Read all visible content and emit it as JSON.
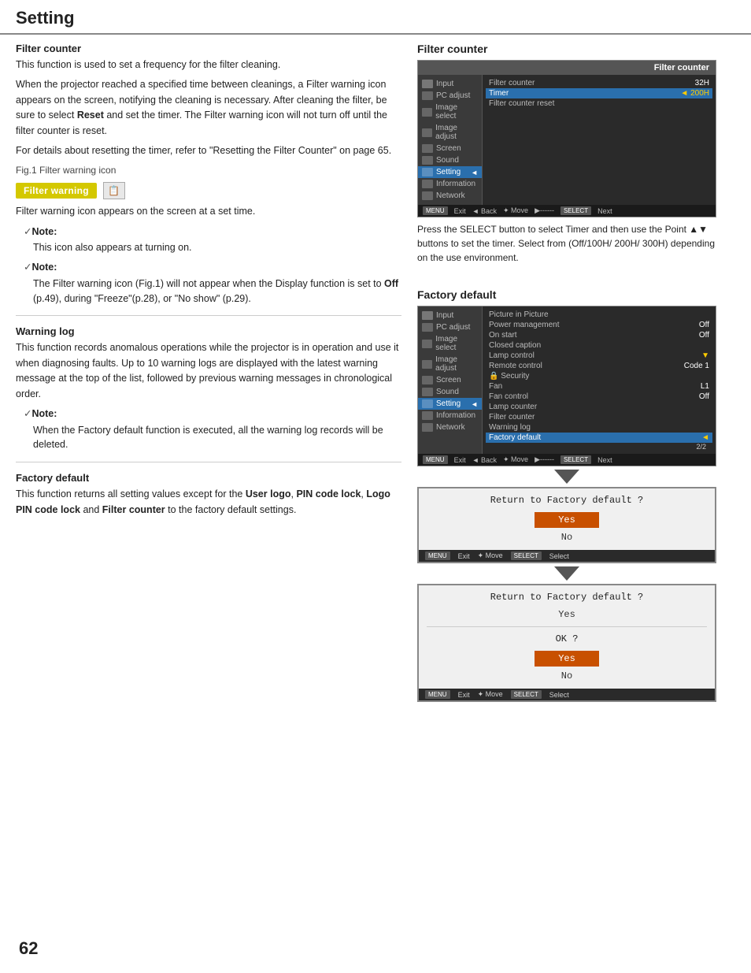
{
  "header": {
    "title": "Setting"
  },
  "page_number": "62",
  "left": {
    "filter_counter": {
      "title": "Filter counter",
      "para1": "This function is used to set a frequency for the filter cleaning.",
      "para2": "When the projector reached a specified time between cleanings, a Filter warning icon appears on the screen, notifying the cleaning is necessary. After cleaning the filter, be sure to select Reset and set the timer. The Filter warning icon will not turn off until the filter counter is reset.",
      "para3": "For details about resetting the timer, refer to \"Resetting the Filter Counter\" on page 65.",
      "fig_label": "Fig.1   Filter warning icon",
      "filter_warning_badge": "Filter warning",
      "note1_label": "Note:",
      "note1_text": "This icon also appears at turning on.",
      "note2_label": "Note:",
      "note2_text": "The Filter warning icon (Fig.1) will not appear when the Display function is set to Off (p.49), during \"Freeze\"(p.28), or \"No show\" (p.29).",
      "para4": "Filter warning icon appears on the screen at a set time."
    },
    "warning_log": {
      "title": "Warning log",
      "para1": "This function records anomalous operations while the projector is in operation and use it when diagnosing faults. Up to 10 warning logs are displayed with the latest warning message at the top of the list, followed by previous warning messages in chronological order.",
      "note_label": "Note:",
      "note_text": "When the Factory default function is executed, all the warning log records will be deleted."
    },
    "factory_default": {
      "title": "Factory default",
      "para1": "This function returns all setting values except for the User logo, PIN code lock, Logo PIN code lock and Filter counter to the factory default settings."
    }
  },
  "right": {
    "filter_counter_section": {
      "label": "Filter counter",
      "panel": {
        "title": "Filter counter",
        "rows": [
          {
            "label": "Filter counter",
            "value": "32H"
          },
          {
            "label": "Timer",
            "value": "200H",
            "highlighted": true
          },
          {
            "label": "Filter counter reset",
            "value": ""
          }
        ],
        "menu_items": [
          {
            "label": "Input",
            "icon": "input"
          },
          {
            "label": "PC adjust",
            "icon": "pc"
          },
          {
            "label": "Image select",
            "icon": "img"
          },
          {
            "label": "Image adjust",
            "icon": "imgadj"
          },
          {
            "label": "Screen",
            "icon": "screen"
          },
          {
            "label": "Sound",
            "icon": "sound"
          },
          {
            "label": "Setting",
            "icon": "setting",
            "active": true
          },
          {
            "label": "Information",
            "icon": "info"
          },
          {
            "label": "Network",
            "icon": "network"
          }
        ],
        "bottom": [
          "Exit",
          "Back",
          "Move",
          "-----",
          "Next"
        ]
      },
      "desc": "Press the SELECT button to select  Timer and then use the Point ▲▼ buttons to set the timer. Select from (Off/100H/ 200H/ 300H) depending on the use environment."
    },
    "factory_default_section": {
      "label": "Factory default",
      "panel": {
        "rows": [
          {
            "label": "Picture in Picture",
            "value": ""
          },
          {
            "label": "Power management",
            "value": "Off"
          },
          {
            "label": "On start",
            "value": "Off"
          },
          {
            "label": "Closed caption",
            "value": ""
          },
          {
            "label": "Lamp control",
            "value": "▼"
          },
          {
            "label": "Remote control",
            "value": "Code 1"
          },
          {
            "label": "🔒 Security",
            "value": ""
          },
          {
            "label": "Fan",
            "value": "L1"
          },
          {
            "label": "Fan control",
            "value": "Off"
          },
          {
            "label": "Lamp counter",
            "value": ""
          },
          {
            "label": "Filter counter",
            "value": ""
          },
          {
            "label": "Warning log",
            "value": ""
          },
          {
            "label": "Factory default",
            "value": "◄",
            "highlighted": true
          }
        ],
        "page_indicator": "2/2",
        "bottom": [
          "Exit",
          "Back",
          "Move",
          "-----",
          "Next"
        ]
      }
    },
    "dialog1": {
      "title": "Return to Factory default ?",
      "buttons": [
        "Yes",
        "No"
      ],
      "active_button": "Yes",
      "bottom": [
        "Exit",
        "Move",
        "Select"
      ]
    },
    "dialog2": {
      "title": "Return to Factory default ?",
      "yes_label": "Yes",
      "ok_label": "OK ?",
      "ok_buttons": [
        "Yes",
        "No"
      ],
      "active_ok_button": "Yes",
      "bottom": [
        "Exit",
        "Move",
        "Select"
      ]
    }
  }
}
